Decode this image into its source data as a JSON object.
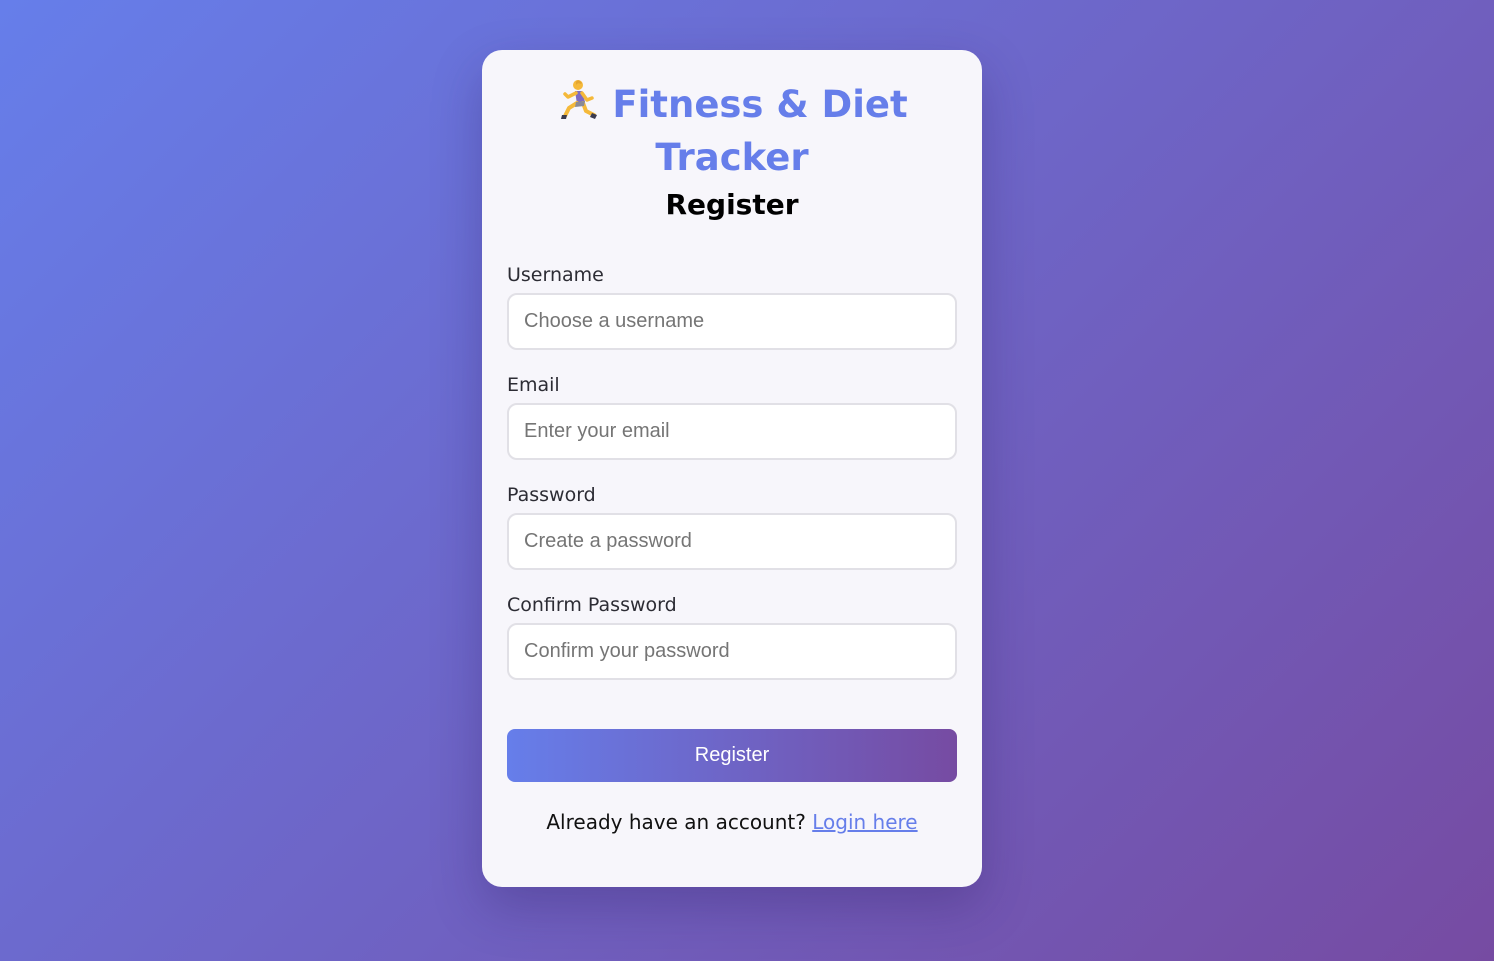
{
  "header": {
    "app_title": "Fitness & Diet Tracker",
    "app_icon": "running-person-icon",
    "page_title": "Register"
  },
  "form": {
    "fields": [
      {
        "label": "Username",
        "placeholder": "Choose a username",
        "value": ""
      },
      {
        "label": "Email",
        "placeholder": "Enter your email",
        "value": ""
      },
      {
        "label": "Password",
        "placeholder": "Create a password",
        "value": ""
      },
      {
        "label": "Confirm Password",
        "placeholder": "Confirm your password",
        "value": ""
      }
    ],
    "submit_label": "Register"
  },
  "footer": {
    "prompt_text": "Already have an account?",
    "login_link_label": "Login here"
  },
  "colors": {
    "accent": "#667eea",
    "accent_end": "#764ba2",
    "card_background": "#f7f6fb"
  }
}
